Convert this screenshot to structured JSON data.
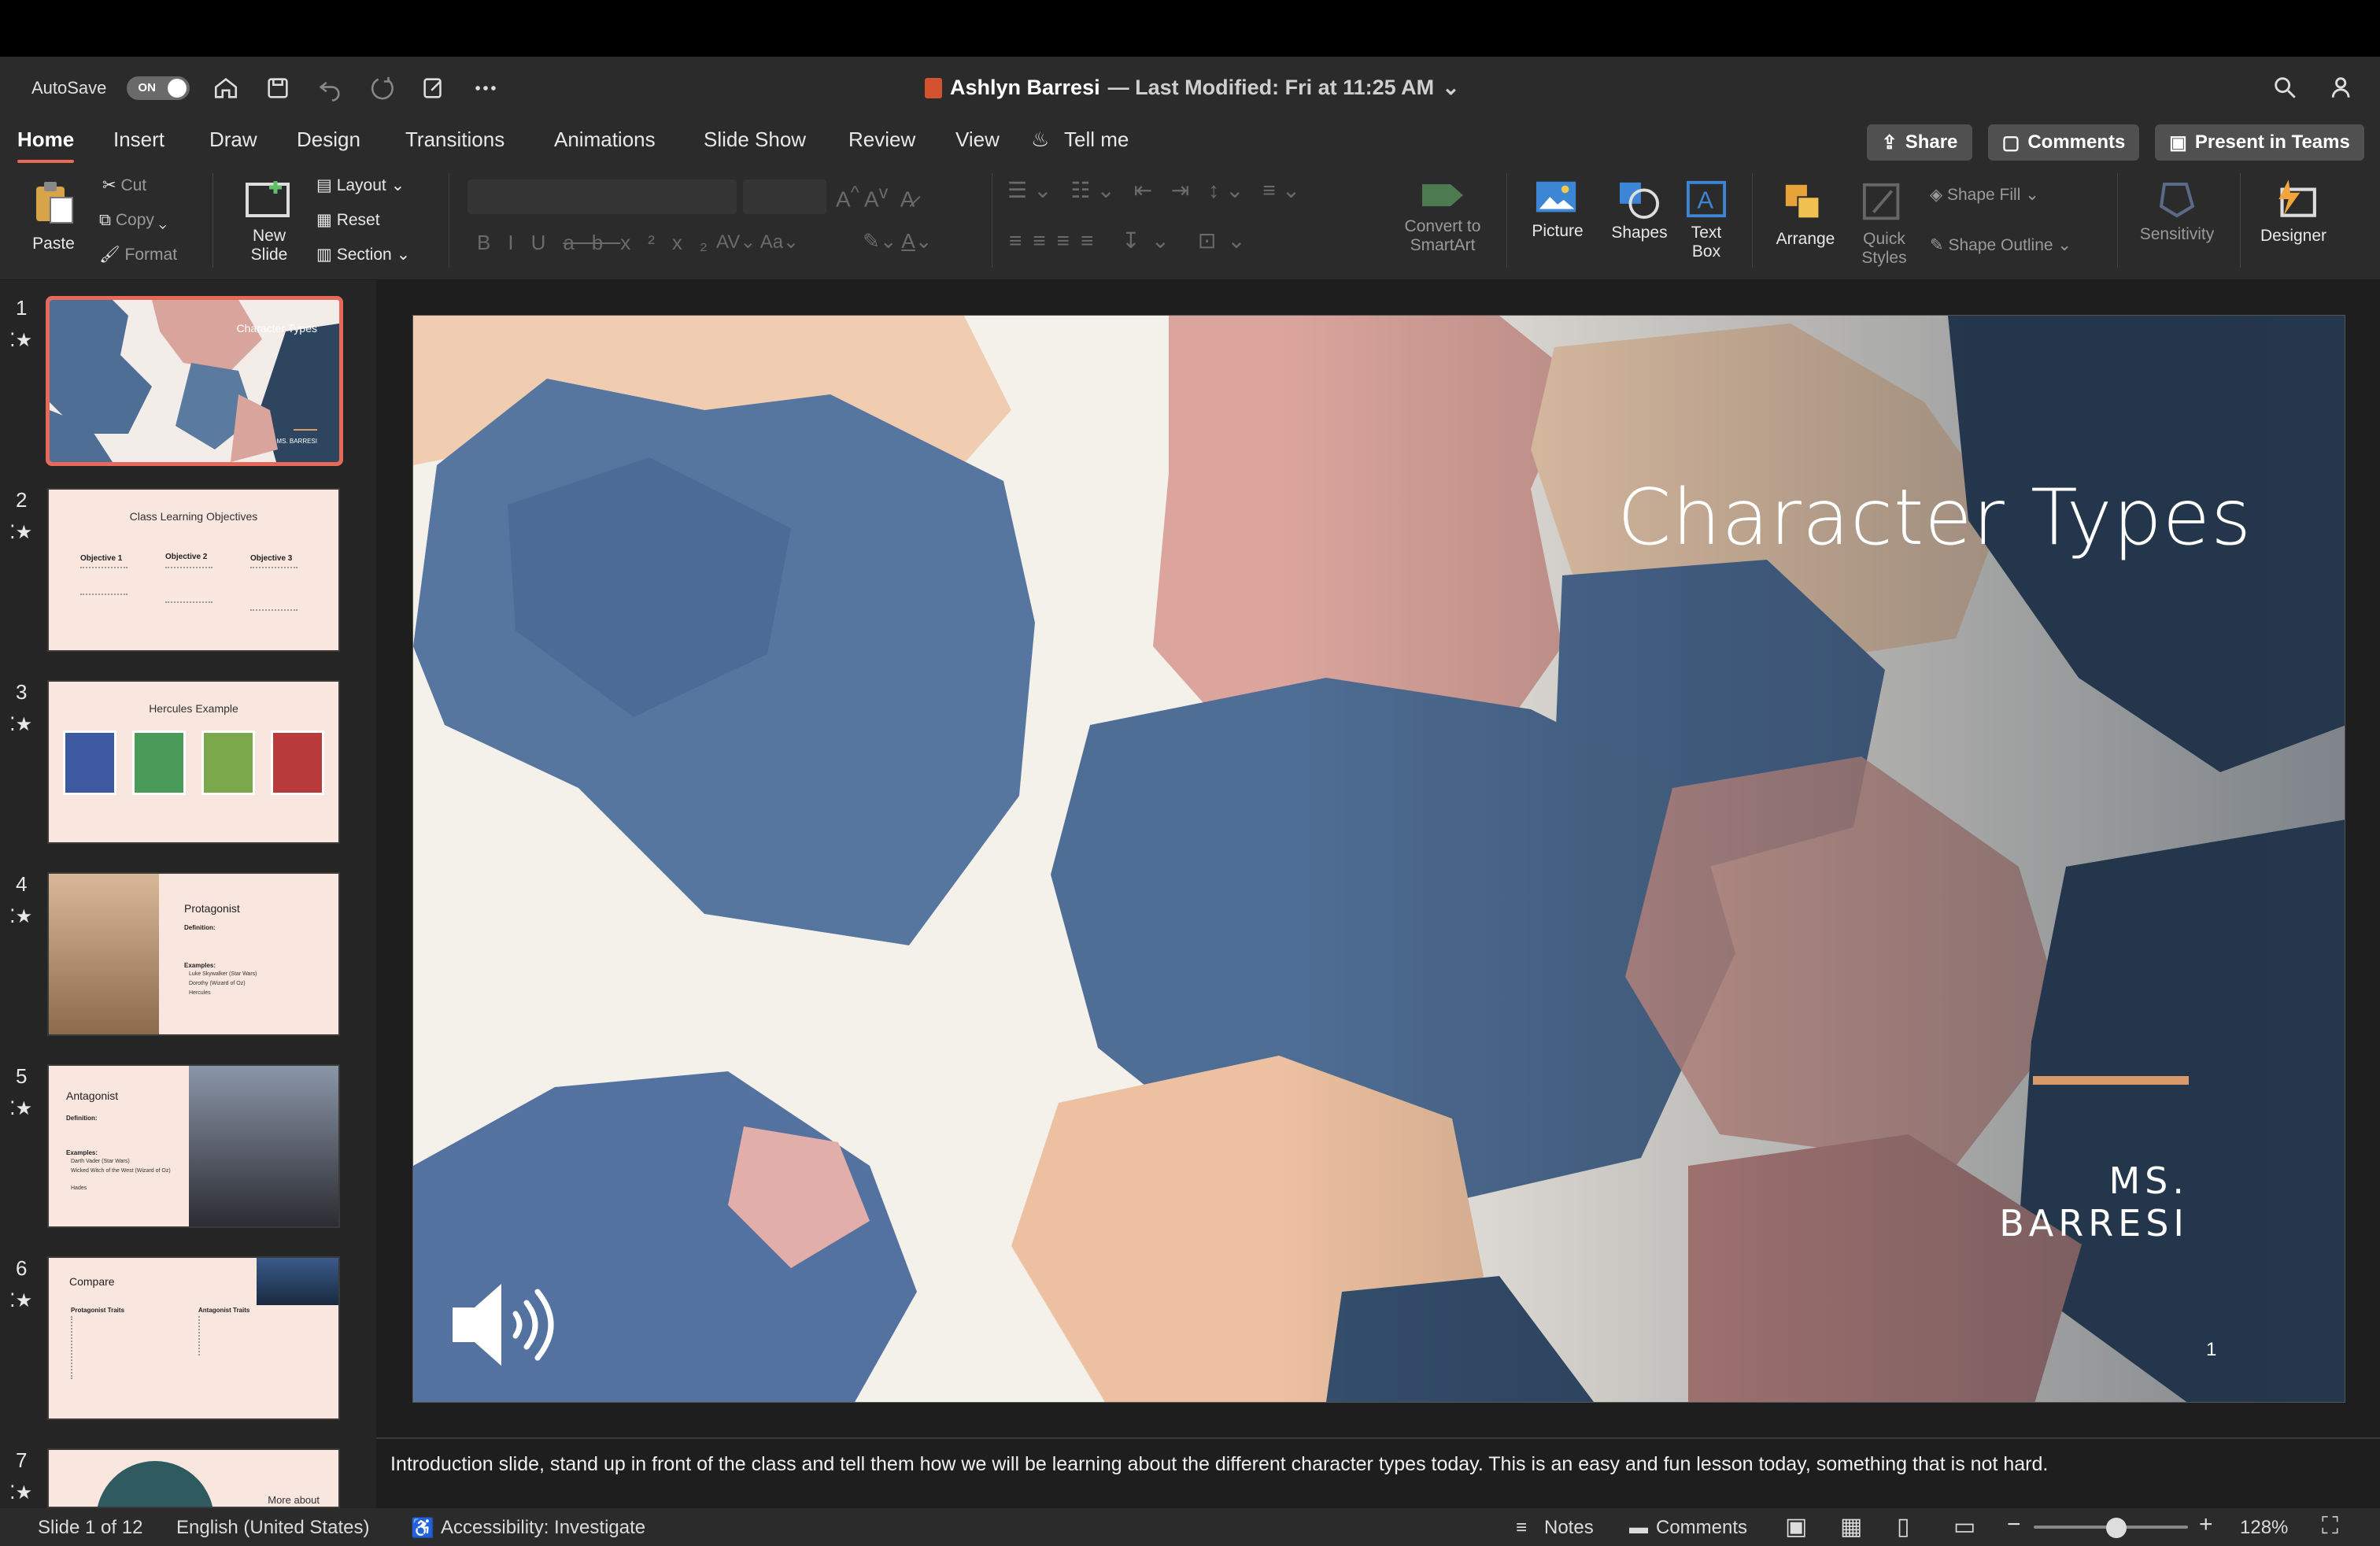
{
  "titlebar": {
    "autosave_label": "AutoSave",
    "autosave_state": "ON",
    "doc_name": "Ashlyn Barresi",
    "last_modified": "— Last Modified: Fri at 11:25 AM"
  },
  "tabs": [
    "Home",
    "Insert",
    "Draw",
    "Design",
    "Transitions",
    "Animations",
    "Slide Show",
    "Review",
    "View",
    "Tell me"
  ],
  "top_buttons": {
    "share": "Share",
    "comments": "Comments",
    "present": "Present in Teams"
  },
  "ribbon": {
    "paste": "Paste",
    "cut": "Cut",
    "copy": "Copy",
    "format": "Format",
    "new_slide": "New Slide",
    "layout": "Layout",
    "reset": "Reset",
    "section": "Section",
    "convert_smartart": "Convert to SmartArt",
    "picture": "Picture",
    "shapes": "Shapes",
    "text_box": "Text Box",
    "arrange": "Arrange",
    "quick_styles": "Quick Styles",
    "shape_fill": "Shape Fill",
    "shape_outline": "Shape Outline",
    "sensitivity": "Sensitivity",
    "designer": "Designer",
    "font_size_a": "Aa"
  },
  "thumbnails": [
    {
      "num": "1",
      "title": "Character Types",
      "sub": "MS. BARRESI"
    },
    {
      "num": "2",
      "title": "Class Learning Objectives",
      "cols": [
        "Objective 1",
        "Objective 2",
        "Objective 3"
      ]
    },
    {
      "num": "3",
      "title": "Hercules Example"
    },
    {
      "num": "4",
      "title": "Protagonist",
      "def": "Definition:",
      "ex": "Examples:",
      "items": [
        "Luke Skywalker (Star Wars)",
        "Dorothy (Wizard of Oz)",
        "Hercules"
      ]
    },
    {
      "num": "5",
      "title": "Antagonist",
      "def": "Definition:",
      "ex": "Examples:",
      "items": [
        "Darth Vader (Star Wars)",
        "Wicked Witch of the West (Wizard of Oz)",
        "Hades"
      ]
    },
    {
      "num": "6",
      "title": "Compare",
      "cols": [
        "Protagonist Traits",
        "Antagonist Traits"
      ]
    },
    {
      "num": "7",
      "title": "More about"
    }
  ],
  "slide": {
    "title": "Character Types",
    "subtitle": "MS. BARRESI",
    "page_number": "1"
  },
  "notes": "Introduction slide, stand up in front of the class and tell them how we will be learning about the different character types today. This is an easy and fun lesson today, something that is not hard.",
  "status": {
    "slide_of": "Slide 1 of 12",
    "language": "English (United States)",
    "accessibility": "Accessibility: Investigate",
    "notes": "Notes",
    "comments": "Comments",
    "zoom": "128%"
  },
  "colors": {
    "accent": "#e8695a",
    "bar": "#2b2b2b",
    "slide_blue": "#4f6e95",
    "slide_pink": "#d9a49c",
    "slide_peach": "#f0c8a8",
    "slide_navy": "#2e4560",
    "underline": "#d89a6a"
  }
}
